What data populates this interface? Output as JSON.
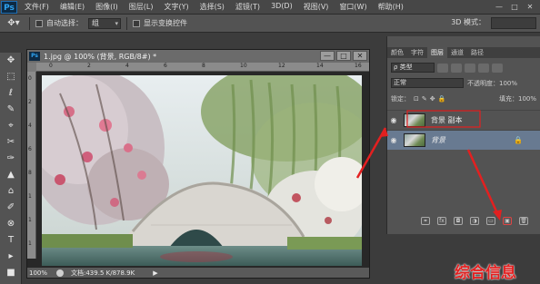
{
  "app": {
    "logo": "Ps",
    "menu": [
      "文件(F)",
      "编辑(E)",
      "图像(I)",
      "图层(L)",
      "文字(Y)",
      "选择(S)",
      "滤镜(T)",
      "3D(D)",
      "视图(V)",
      "窗口(W)",
      "帮助(H)"
    ],
    "window_controls": [
      "—",
      "□",
      "✕"
    ]
  },
  "options": {
    "move_icon": "move-icon",
    "auto_select_label": "自动选择：",
    "auto_select_value": "组",
    "transform_label": "显示变换控件",
    "mode_label": "3D 模式："
  },
  "tools": [
    "✥",
    "⬚",
    "ℓ",
    "✎",
    "⌖",
    "✂",
    "✑",
    "▲",
    "⌂",
    "✐",
    "⊗",
    "T",
    "▸",
    "■",
    "◐"
  ],
  "document": {
    "title": "1.jpg @ 100% (背景, RGB/8#) *",
    "icon": "Ps",
    "buttons": [
      "—",
      "□",
      "✕"
    ],
    "ruler_h": [
      "0",
      "2",
      "4",
      "6",
      "8",
      "10",
      "12",
      "14",
      "16"
    ],
    "ruler_v": [
      "0",
      "2",
      "4",
      "6",
      "8",
      "1",
      "1",
      "1"
    ],
    "zoom": "100%",
    "info": "文档:439.5 K/878.9K"
  },
  "layers_panel": {
    "tabs": [
      "颜色",
      "字符",
      "图层",
      "通道",
      "路径"
    ],
    "active_tab_index": 2,
    "filter_label": "ρ 类型",
    "blend_mode": "正常",
    "opacity_label": "不透明度：100%",
    "lock_label": "锁定：",
    "fill_label": "填充：100%",
    "layers": [
      {
        "name": "背景 副本",
        "selected": false
      },
      {
        "name": "背景",
        "selected": true
      }
    ],
    "lock_icon": "lock-icon",
    "footer_icons": [
      "link-icon",
      "fx-icon",
      "mask-icon",
      "adjustment-icon",
      "group-icon",
      "new-layer-icon",
      "trash-icon"
    ]
  },
  "watermark": "综合信息",
  "colors": {
    "annotation_red": "#e32020",
    "selected_layer": "#687a91"
  }
}
